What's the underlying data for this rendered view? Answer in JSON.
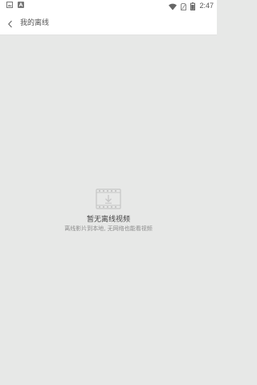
{
  "status_bar": {
    "time": "2:47",
    "left_icons": [
      "image-notification-icon",
      "app-notification-icon"
    ],
    "right_icons": [
      "wifi-icon",
      "no-sim-icon",
      "battery-icon"
    ]
  },
  "header": {
    "back_icon": "chevron-left-icon",
    "title": "我的离线"
  },
  "empty_state": {
    "icon": "film-download-icon",
    "title": "暂无离线视频",
    "subtitle": "离线影片到本地, 无网络也能看视频"
  }
}
